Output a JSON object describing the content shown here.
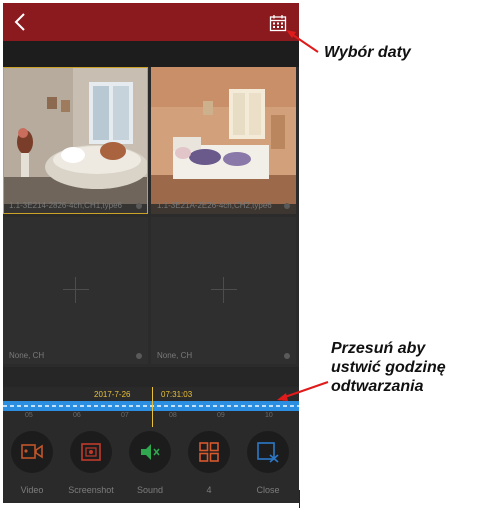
{
  "app": {
    "top_bar": {
      "back_icon": "back-chevron-icon",
      "calendar_icon": "calendar-icon",
      "color": "#8b1a1f"
    },
    "cameras": [
      {
        "label": "1.1-3E214-2826-4ch,CH1,type6",
        "state": "video",
        "selected": true
      },
      {
        "label": "1.1-3E21A-2E26-4ch,CH2,type6",
        "state": "video",
        "selected": false
      },
      {
        "label": "None, CH",
        "state": "empty",
        "selected": false
      },
      {
        "label": "None, CH",
        "state": "empty",
        "selected": false
      }
    ],
    "timeline": {
      "date": "2017-7-26",
      "time": "07:31:03",
      "track_color": "#2c8ee0",
      "ticks": [
        "05",
        "06",
        "07",
        "08",
        "09",
        "10"
      ]
    },
    "controls": [
      {
        "label": "Video",
        "icon": "video-camera-icon",
        "color": "#c0562a"
      },
      {
        "label": "Screenshot",
        "icon": "screenshot-icon",
        "color": "#c03a2b"
      },
      {
        "label": "Sound",
        "icon": "speaker-muted-icon",
        "color": "#2fa84f"
      },
      {
        "label": "4",
        "icon": "grid-four-icon",
        "color": "#d6582d"
      },
      {
        "label": "Close",
        "icon": "close-window-icon",
        "color": "#2c78c8"
      }
    ]
  },
  "annotations": {
    "date_picker": "Wybór daty",
    "timeline_line1": "Przesuń aby",
    "timeline_line2": "ustwić godzinę",
    "timeline_line3": "odtwarzania"
  }
}
